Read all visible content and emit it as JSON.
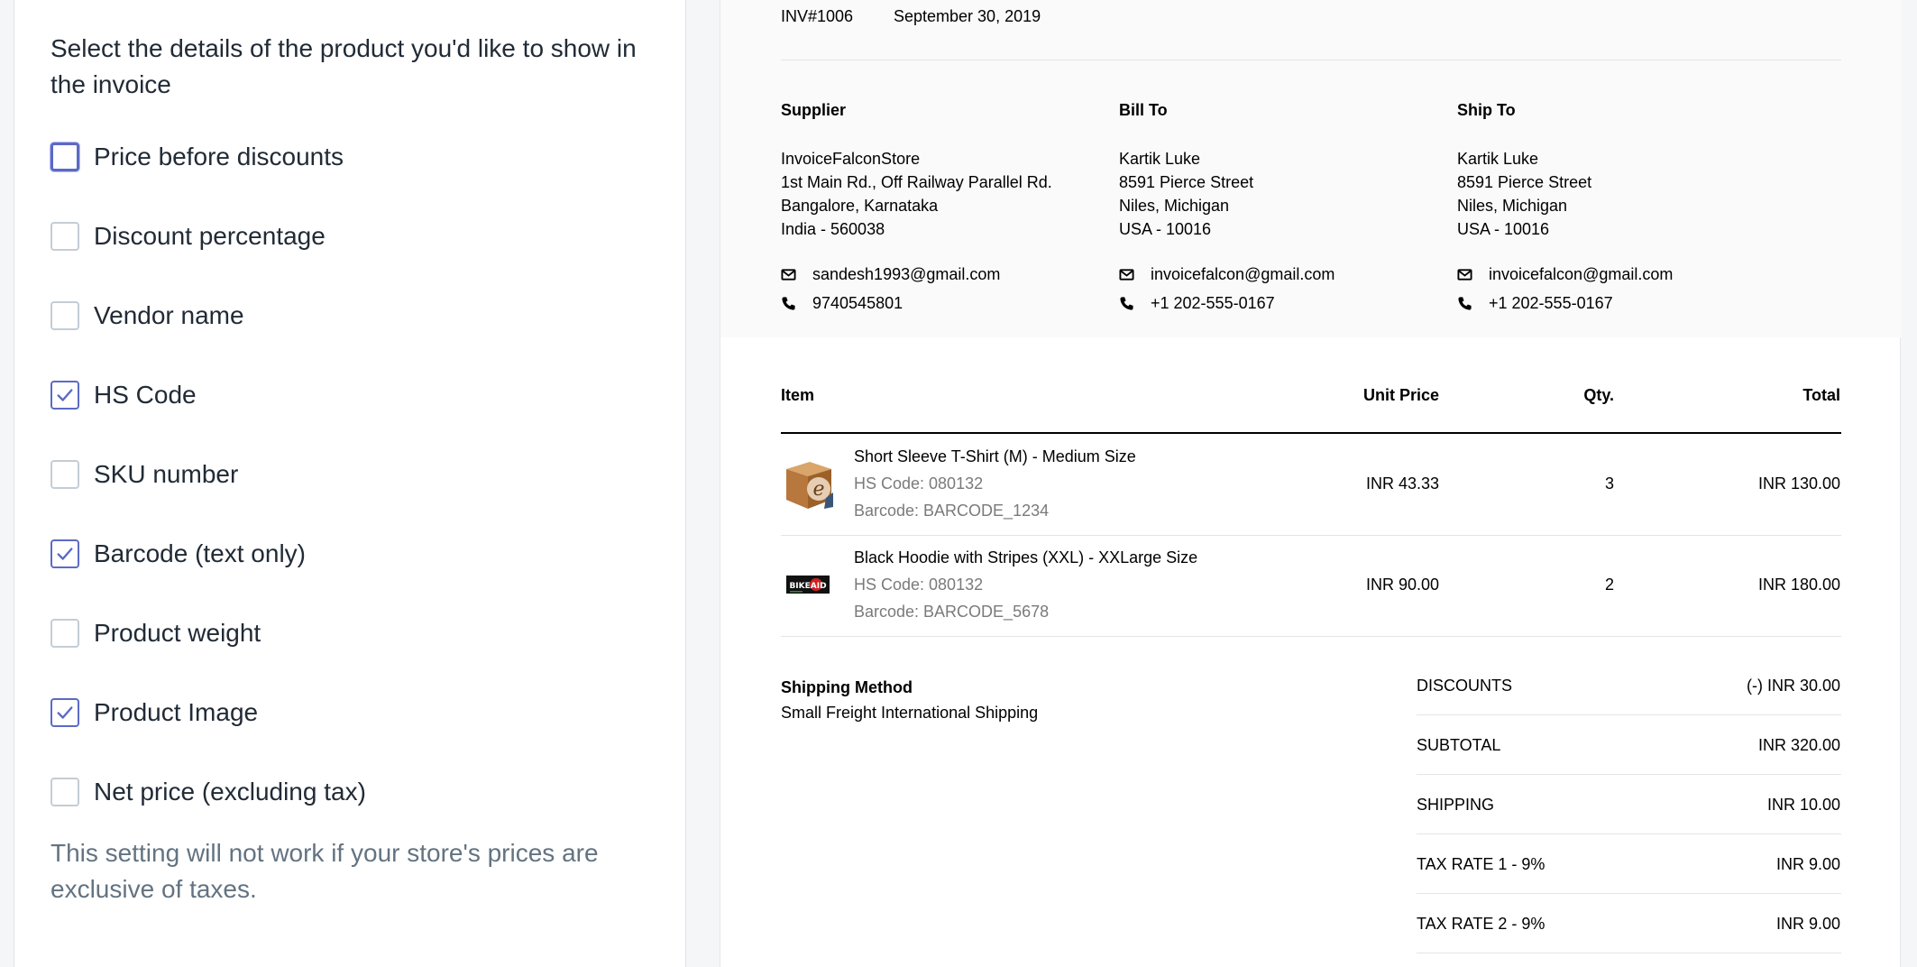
{
  "settings": {
    "title": "Select the details of the product you'd like to show in the invoice",
    "options": [
      {
        "label": "Price before discounts",
        "checked": false
      },
      {
        "label": "Discount percentage",
        "checked": false
      },
      {
        "label": "Vendor name",
        "checked": false
      },
      {
        "label": "HS Code",
        "checked": true
      },
      {
        "label": "SKU number",
        "checked": false
      },
      {
        "label": "Barcode (text only)",
        "checked": true
      },
      {
        "label": "Product weight",
        "checked": false
      },
      {
        "label": "Product Image",
        "checked": true
      },
      {
        "label": "Net price (excluding tax)",
        "checked": false
      }
    ],
    "help_text": "This setting will not work if your store's prices are exclusive of taxes.",
    "accent_color": "#5c6ac4"
  },
  "invoice": {
    "number": "INV#1006",
    "date": "September 30, 2019",
    "supplier": {
      "heading": "Supplier",
      "lines": [
        "InvoiceFalconStore",
        "1st Main Rd., Off Railway Parallel Rd.",
        "Bangalore, Karnataka",
        "India - 560038"
      ],
      "email": "sandesh1993@gmail.com",
      "phone": "9740545801"
    },
    "bill_to": {
      "heading": "Bill To",
      "lines": [
        "Kartik Luke",
        "8591 Pierce Street",
        "Niles, Michigan",
        "USA - 10016"
      ],
      "email": "invoicefalcon@gmail.com",
      "phone": "+1 202-555-0167"
    },
    "ship_to": {
      "heading": "Ship To",
      "lines": [
        "Kartik Luke",
        "8591 Pierce Street",
        "Niles, Michigan",
        "USA - 10016"
      ],
      "email": "invoicefalcon@gmail.com",
      "phone": "+1 202-555-0167"
    },
    "table_headers": {
      "item": "Item",
      "unit_price": "Unit Price",
      "qty": "Qty.",
      "total": "Total"
    },
    "items": [
      {
        "name": "Short Sleeve T-Shirt (M) - Medium Size",
        "hs_code": "HS Code: 080132",
        "barcode": "Barcode: BARCODE_1234",
        "unit_price": "INR 43.33",
        "qty": "3",
        "total": "INR 130.00",
        "image": "box-e-logo-icon"
      },
      {
        "name": "Black Hoodie with Stripes (XXL) - XXLarge Size",
        "hs_code": "HS Code: 080132",
        "barcode": "Barcode: BARCODE_5678",
        "unit_price": "INR 90.00",
        "qty": "2",
        "total": "INR 180.00",
        "image": "bikeaid-logo-icon",
        "image_text": "BIKEAID"
      }
    ],
    "shipping_method": {
      "heading": "Shipping Method",
      "value": "Small Freight International Shipping"
    },
    "summary": [
      {
        "label": "DISCOUNTS",
        "value": "(-) INR 30.00"
      },
      {
        "label": "SUBTOTAL",
        "value": "INR 320.00"
      },
      {
        "label": "SHIPPING",
        "value": "INR 10.00"
      },
      {
        "label": "TAX RATE 1 - 9%",
        "value": "INR 9.00"
      },
      {
        "label": "TAX RATE 2 - 9%",
        "value": "INR 9.00"
      }
    ]
  }
}
